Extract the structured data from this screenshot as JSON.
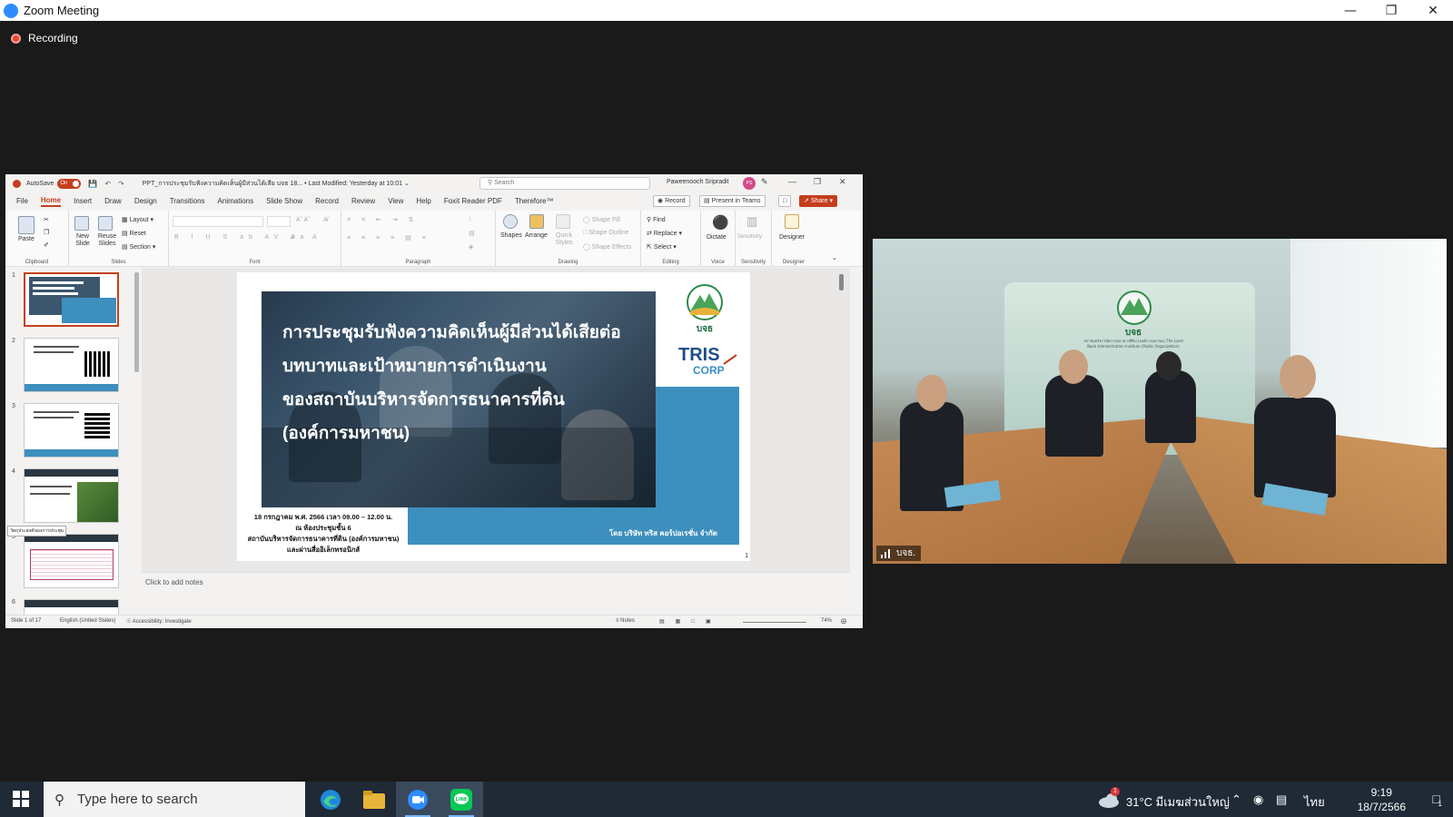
{
  "window": {
    "title": "Zoom Meeting",
    "recording": "Recording"
  },
  "ppt": {
    "autosave_label": "AutoSave",
    "autosave_state": "On",
    "doc_title": "PPT_การประชุมรับฟังความคิดเห็นผู้มีส่วนได้เสีย บจธ 18... • Last Modified: Yesterday at 10:01 ⌄",
    "search_placeholder": "Search",
    "user_name": "Paweenooch Sripradit",
    "user_initials": "PS",
    "tabs": [
      "File",
      "Home",
      "Insert",
      "Draw",
      "Design",
      "Transitions",
      "Animations",
      "Slide Show",
      "Record",
      "Review",
      "View",
      "Help",
      "Foxit Reader PDF",
      "Therefore™"
    ],
    "record_btn": "Record",
    "present_btn": "Present in Teams",
    "share_btn": "Share",
    "ribbon": {
      "paste": "Paste",
      "new_slide": "New Slide",
      "reuse_slides": "Reuse Slides",
      "layout": "Layout",
      "reset": "Reset",
      "section": "Section",
      "shapes": "Shapes",
      "arrange": "Arrange",
      "quick_styles": "Quick Styles",
      "shape_fill": "Shape Fill",
      "shape_outline": "Shape Outline",
      "shape_effects": "Shape Effects",
      "find": "Find",
      "replace": "Replace",
      "select": "Select",
      "dictate": "Dictate",
      "sensitivity": "Sensitivity",
      "designer": "Designer",
      "groups": [
        "Clipboard",
        "Slides",
        "Font",
        "Paragraph",
        "Drawing",
        "Editing",
        "Voice",
        "Sensitivity",
        "Designer"
      ]
    },
    "thumbs": [
      "1",
      "2",
      "3",
      "4",
      "5",
      "6"
    ],
    "thumb_tooltip": "วัตถุประสงค์ของการประชุม",
    "slide": {
      "headline": [
        "การประชุมรับฟังความคิดเห็นผู้มีส่วนได้เสียต่อ",
        "บทบาทและเป้าหมายการดำเนินงาน",
        "ของสถาบันบริหารจัดการธนาคารที่ดิน",
        "(องค์การมหาชน)"
      ],
      "event_info": [
        "18 กรกฎาคม พ.ศ. 2566 เวลา 09.00 – 12.00 น.",
        "ณ ห้องประชุมชั้น 6",
        "สถาบันบริหารจัดการธนาคารที่ดิน (องค์การมหาชน)",
        "และผ่านสื่ออิเล็กทรอนิกส์"
      ],
      "byline": "โดย บริษัท ทริส คอร์ปอเรชั่น จำกัด",
      "logo_bor": "บจธ",
      "logo_tris": "TRIS",
      "logo_corp": "CORP",
      "page": "1"
    },
    "notes_placeholder": "Click to add notes",
    "status": {
      "slide_count": "Slide 1 of 17",
      "language": "English (United States)",
      "accessibility": "Accessibility: Investigate",
      "notes": "Notes",
      "zoom": "74%"
    }
  },
  "video": {
    "participant": "บจธ.",
    "wall_logo": "บจธ",
    "wall_caption": "สถาบันบริหารจัดการธนาคารที่ดิน (องค์การมหาชน) The Land Bank Administration Institute (Public Organization)"
  },
  "taskbar": {
    "search_placeholder": "Type here to search",
    "weather": "31°C  มีเมฆส่วนใหญ่",
    "weather_badge": "1",
    "language": "ไทย",
    "time": "9:19",
    "date": "18/7/2566",
    "notif_count": "1"
  },
  "colors": {
    "ppt_accent": "#c43e1c",
    "slide_blue": "#3d8fbd",
    "zoom_blue": "#2d8cff",
    "taskbar": "#1f2a36"
  }
}
